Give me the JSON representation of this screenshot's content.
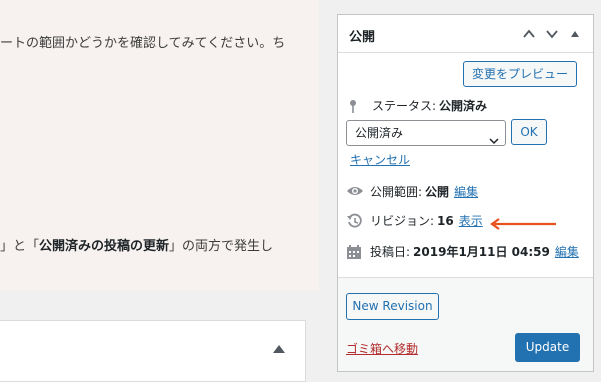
{
  "editor": {
    "line1": "ートの範囲かどうかを確認してみてください。ち",
    "line2_prefix": "」と「",
    "line2_bold": "公開済みの投稿の更新",
    "line2_suffix": "」の両方で発生し"
  },
  "publish_box": {
    "title": "公開",
    "preview_label": "変更をプレビュー",
    "status_label": "ステータス:",
    "status_value": "公開済み",
    "select_value": "公開済み",
    "ok_label": "OK",
    "cancel_label": "キャンセル",
    "visibility_label": "公開範囲:",
    "visibility_value": "公開",
    "visibility_edit": "編集",
    "revision_label": "リビジョン:",
    "revision_value": "16",
    "revision_show": "表示",
    "date_label": "投稿日:",
    "date_value": "2019年1月11日 04:59",
    "date_edit": "編集",
    "new_revision_label": "New Revision",
    "trash_label": "ゴミ箱へ移動",
    "update_label": "Update"
  },
  "colors": {
    "accent": "#2271b1",
    "danger": "#b32d2e",
    "arrow": "#e8521f"
  },
  "icons": [
    "chevron-up-icon",
    "chevron-down-icon",
    "toggle-triangle-icon",
    "pin-icon",
    "eye-icon",
    "history-icon",
    "calendar-icon",
    "arrow-left-icon"
  ]
}
